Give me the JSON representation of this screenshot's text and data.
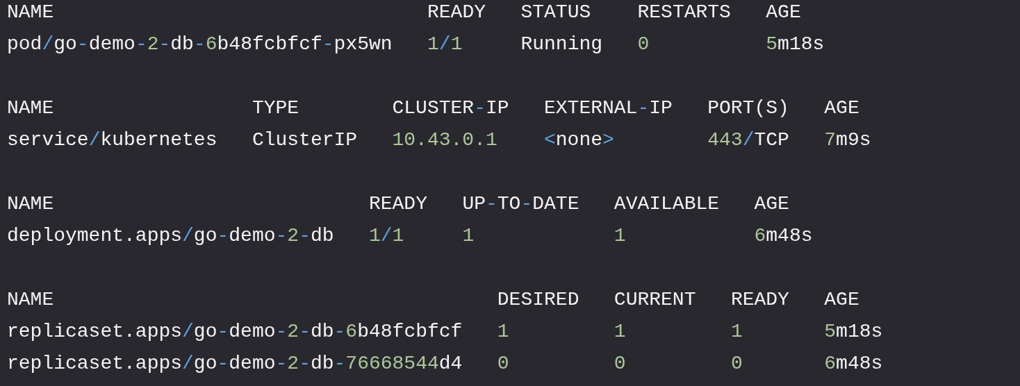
{
  "tables": [
    {
      "columns": [
        "NAME",
        "READY",
        "STATUS",
        "RESTARTS",
        "AGE"
      ],
      "rows": [
        [
          "pod/go-demo-2-db-6b48fcbfcf-px5wn",
          "1/1",
          "Running",
          "0",
          "5m18s"
        ]
      ]
    },
    {
      "columns": [
        "NAME",
        "TYPE",
        "CLUSTER-IP",
        "EXTERNAL-IP",
        "PORT(S)",
        "AGE"
      ],
      "rows": [
        [
          "service/kubernetes",
          "ClusterIP",
          "10.43.0.1",
          "<none>",
          "443/TCP",
          "7m9s"
        ]
      ]
    },
    {
      "columns": [
        "NAME",
        "READY",
        "UP-TO-DATE",
        "AVAILABLE",
        "AGE"
      ],
      "rows": [
        [
          "deployment.apps/go-demo-2-db",
          "1/1",
          "1",
          "1",
          "6m48s"
        ]
      ]
    },
    {
      "columns": [
        "NAME",
        "DESIRED",
        "CURRENT",
        "READY",
        "AGE"
      ],
      "rows": [
        [
          "replicaset.apps/go-demo-2-db-6b48fcbfcf",
          "1",
          "1",
          "1",
          "5m18s"
        ],
        [
          "replicaset.apps/go-demo-2-db-76668544d4",
          "0",
          "0",
          "0",
          "6m48s"
        ]
      ]
    }
  ]
}
